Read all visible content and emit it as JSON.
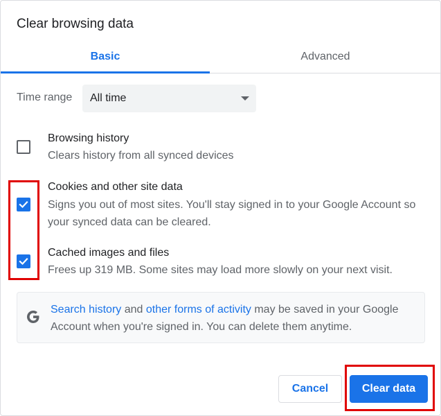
{
  "dialog": {
    "title": "Clear browsing data"
  },
  "tabs": [
    {
      "label": "Basic",
      "selected": true
    },
    {
      "label": "Advanced",
      "selected": false
    }
  ],
  "time_range": {
    "label": "Time range",
    "selected": "All time"
  },
  "items": [
    {
      "title": "Browsing history",
      "description": "Clears history from all synced devices",
      "checked": false
    },
    {
      "title": "Cookies and other site data",
      "description": "Signs you out of most sites. You'll stay signed in to your Google Account so your synced data can be cleared.",
      "checked": true
    },
    {
      "title": "Cached images and files",
      "description": "Frees up 319 MB. Some sites may load more slowly on your next visit.",
      "checked": true
    }
  ],
  "info": {
    "icon": "google-g-icon",
    "link1": "Search history",
    "text1": " and ",
    "link2": "other forms of activity",
    "text2": " may be saved in your Google Account when you're signed in. You can delete them anytime."
  },
  "buttons": {
    "cancel": "Cancel",
    "clear": "Clear data"
  },
  "colors": {
    "accent": "#1a73e8",
    "highlight": "#e00000"
  }
}
